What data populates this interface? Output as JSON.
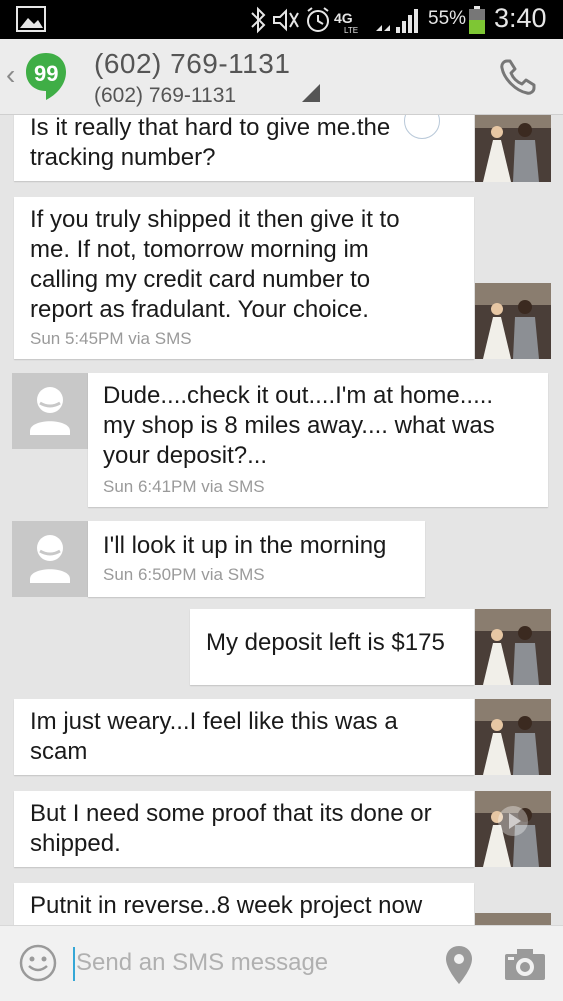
{
  "status_bar": {
    "battery_percent": "55%",
    "time": "3:40",
    "network": "4G LTE",
    "icons": [
      "gallery-icon",
      "bluetooth-icon",
      "mute-icon",
      "alarm-icon",
      "4g-lte-icon",
      "signal-icon",
      "battery-icon"
    ]
  },
  "header": {
    "contact_name": "(602) 769-1131",
    "contact_number": "(602) 769-1131",
    "back_glyph": "‹",
    "logo_glyph": "99",
    "app_color": "#3fae46"
  },
  "messages": [
    {
      "side": "sent",
      "text": "Is it really that hard to give me.the\ntracking number?",
      "time": ""
    },
    {
      "side": "sent",
      "text": "If you truly shipped it then give it to\nme.  If not, tomorrow morning im\ncalling my credit card number to\nreport as fradulant. Your choice.",
      "time": "Sun 5:45PM via SMS"
    },
    {
      "side": "received",
      "text": "Dude....check it out....I'm at home.....\nmy shop is 8 miles away.... what was\nyour deposit?...",
      "time": "Sun 6:41PM via SMS"
    },
    {
      "side": "received",
      "text": "I'll look it up in the morning",
      "time": "Sun 6:50PM via SMS"
    },
    {
      "side": "sent",
      "text": "My deposit left is $175",
      "time": ""
    },
    {
      "side": "sent",
      "text": "Im just weary...I feel like this was a\nscam",
      "time": ""
    },
    {
      "side": "sent",
      "text": "But I need some proof that its done or\nshipped.",
      "time": ""
    },
    {
      "side": "sent",
      "text": "Putnit in reverse..8 week project now",
      "time": ""
    }
  ],
  "composer": {
    "placeholder": "Send an SMS message"
  },
  "colors": {
    "background": "#e5e5e5",
    "bubble": "#ffffff",
    "header": "#ececec",
    "accent_cursor": "#35a7d6"
  }
}
